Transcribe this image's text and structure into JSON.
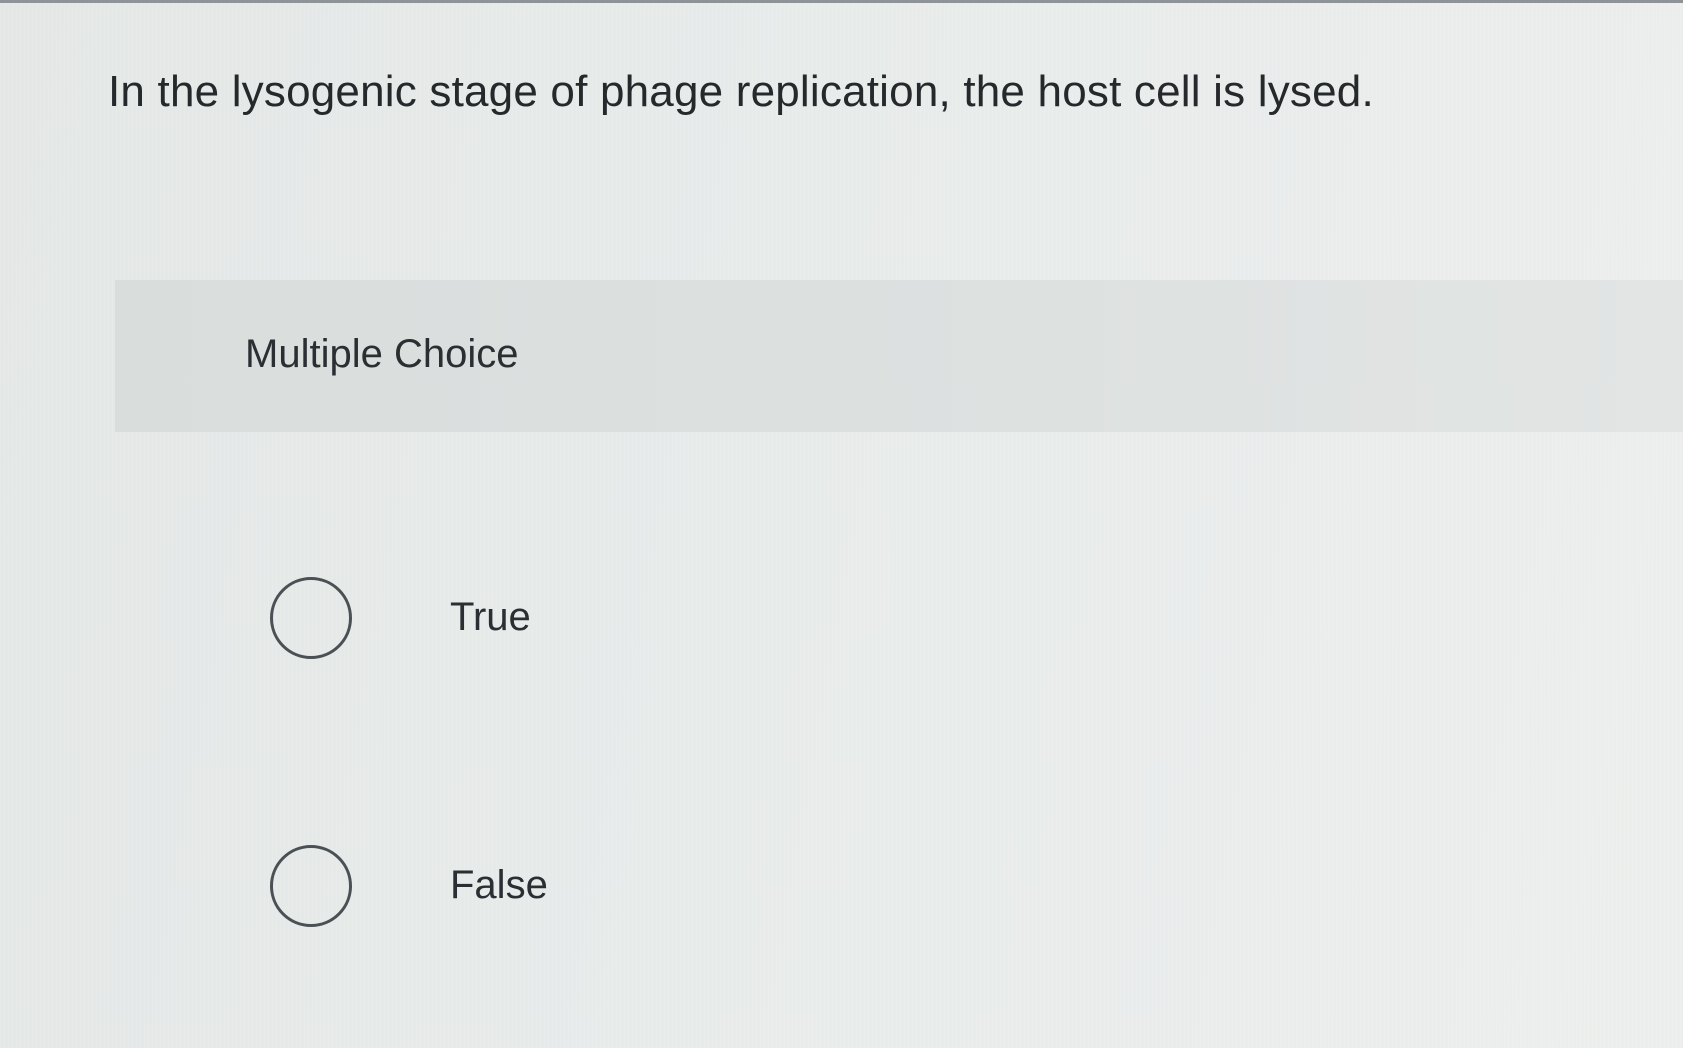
{
  "question": {
    "text": "In the lysogenic stage of phage replication, the host cell is lysed."
  },
  "question_type": {
    "label": "Multiple Choice"
  },
  "options": [
    {
      "label": "True",
      "selected": false
    },
    {
      "label": "False",
      "selected": false
    }
  ]
}
